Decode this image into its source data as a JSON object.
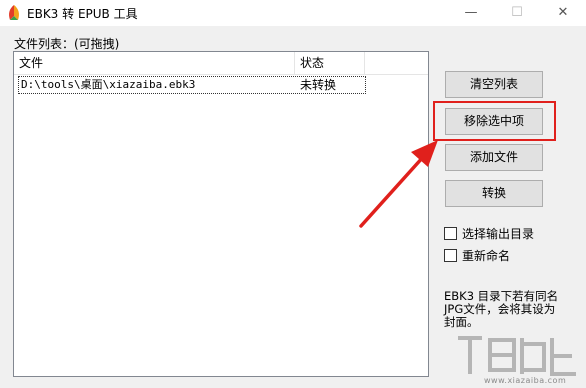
{
  "window": {
    "title": "EBK3 转 EPUB 工具",
    "min_glyph": "—",
    "max_glyph": "☐",
    "close_glyph": "✕"
  },
  "file_list": {
    "label": "文件列表：(可拖拽)",
    "columns": [
      "文件",
      "状态"
    ],
    "rows": [
      {
        "file": "D:\\tools\\桌面\\xiazaiba.ebk3",
        "status": "未转换"
      }
    ]
  },
  "buttons": {
    "clear": "清空列表",
    "remove": "移除选中项",
    "add": "添加文件",
    "convert": "转换"
  },
  "options": {
    "select_output": "选择输出目录",
    "rename": "重新命名"
  },
  "note": "EBK3 目录下若有同名JPG文件，会将其设为封面。",
  "watermark": {
    "site": "www.xiazaiba.com"
  },
  "colors": {
    "highlight": "#e0201c",
    "arrow": "#e0201c"
  }
}
